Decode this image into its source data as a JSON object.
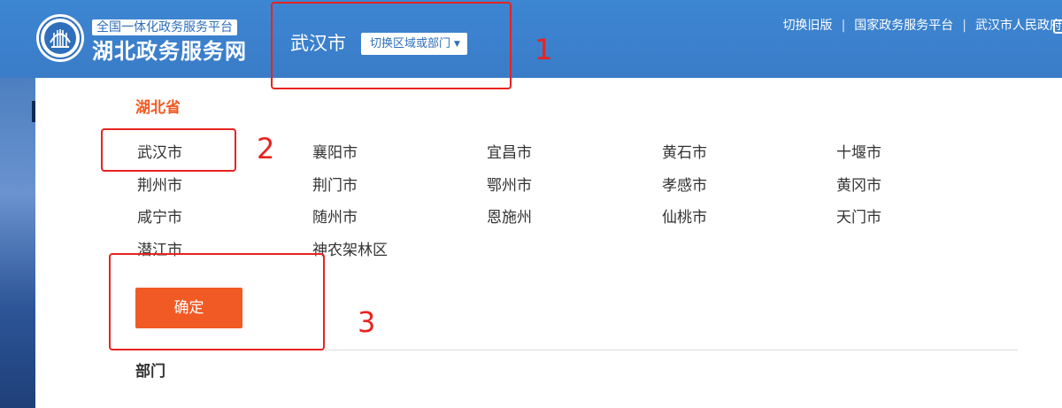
{
  "header": {
    "slogan": "全国一体化政务服务平台",
    "site_title": "湖北政务服务网",
    "current_city": "武汉市",
    "switch_label": "切换区域或部门",
    "links": [
      "切换旧版",
      "国家政务服务平台",
      "武汉市人民政府"
    ],
    "link_separator": "|"
  },
  "panel": {
    "province_title": "湖北省",
    "cities": [
      [
        "武汉市",
        "襄阳市",
        "宜昌市",
        "黄石市",
        "十堰市"
      ],
      [
        "荆州市",
        "荆门市",
        "鄂州市",
        "孝感市",
        "黄冈市"
      ],
      [
        "咸宁市",
        "随州市",
        "恩施州",
        "仙桃市",
        "天门市"
      ],
      [
        "潜江市",
        "神农架林区"
      ]
    ],
    "confirm_label": "确定",
    "department_title": "部门"
  },
  "annotations": {
    "labels": [
      "1",
      "2",
      "3"
    ],
    "color": "#e8231f"
  },
  "colors": {
    "header_blue": "#3a7cc8",
    "accent_orange": "#f15a24"
  }
}
